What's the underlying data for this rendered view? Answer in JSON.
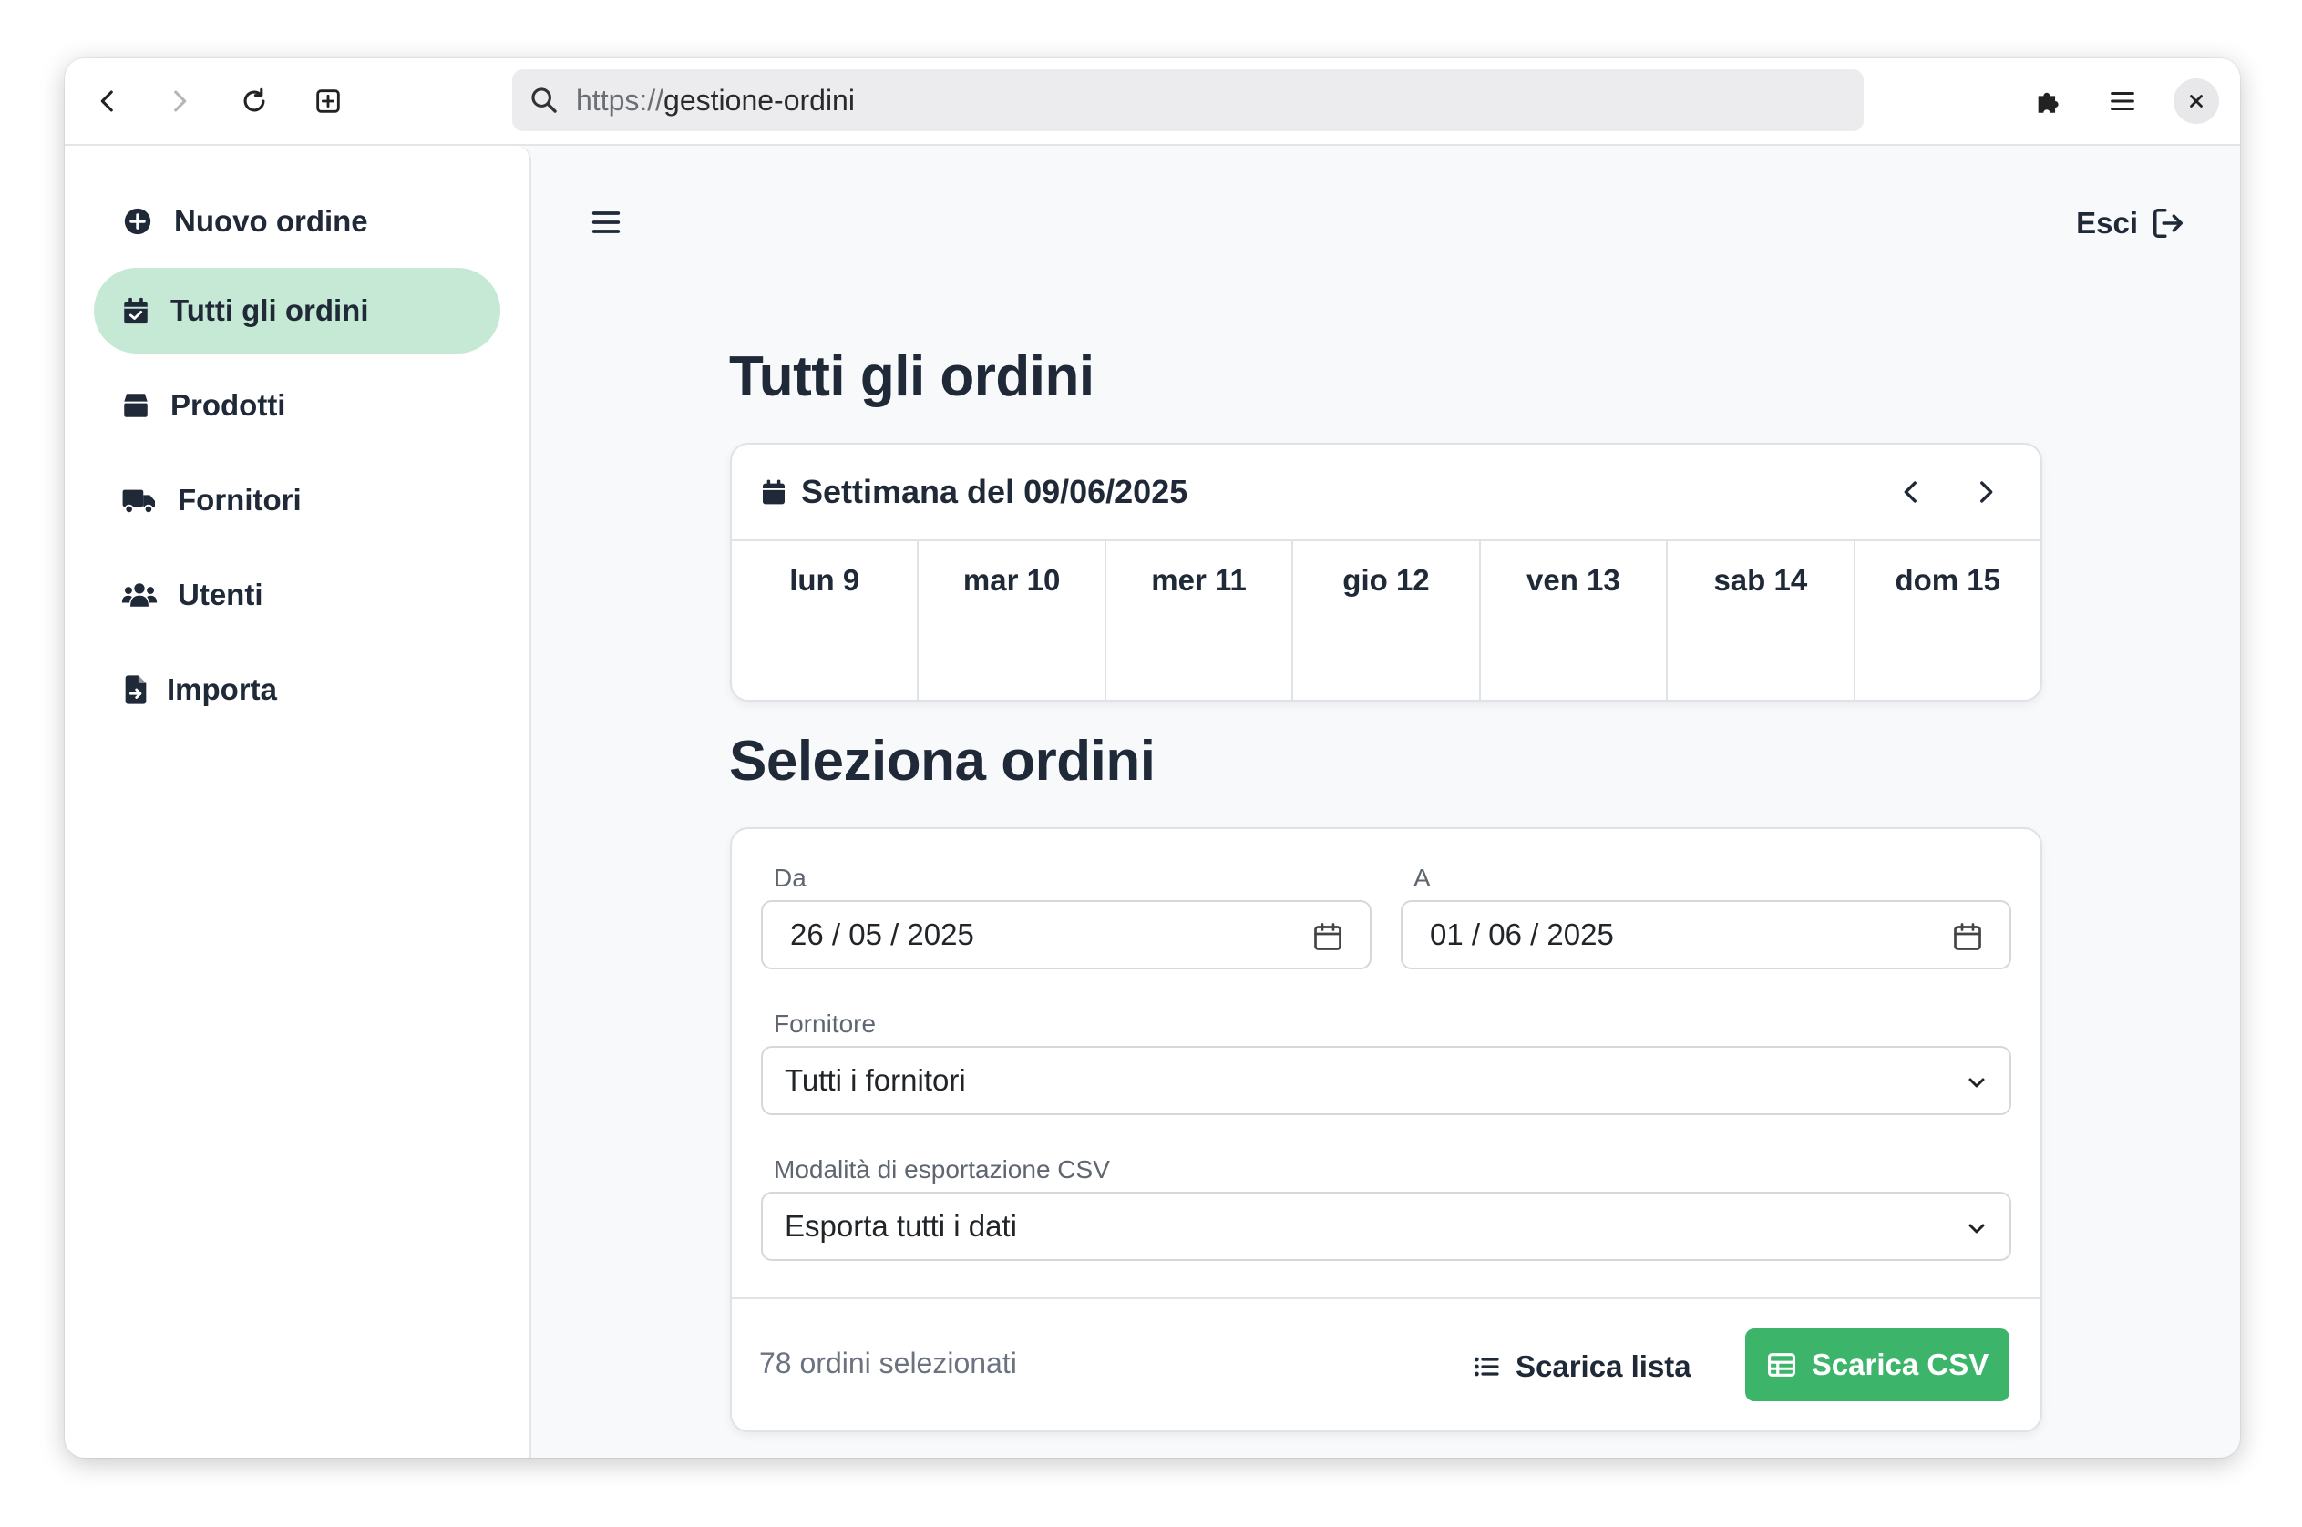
{
  "browser": {
    "url_scheme": "https://",
    "url_host": "gestione-ordini"
  },
  "sidebar": {
    "items": [
      {
        "label": "Nuovo ordine",
        "icon": "plus-circle-icon",
        "active": false
      },
      {
        "label": "Tutti gli ordini",
        "icon": "calendar-check-icon",
        "active": true
      },
      {
        "label": "Prodotti",
        "icon": "box-icon",
        "active": false
      },
      {
        "label": "Fornitori",
        "icon": "truck-icon",
        "active": false
      },
      {
        "label": "Utenti",
        "icon": "users-icon",
        "active": false
      },
      {
        "label": "Importa",
        "icon": "file-import-icon",
        "active": false
      }
    ]
  },
  "header": {
    "logout_label": "Esci"
  },
  "orders": {
    "title": "Tutti gli ordini",
    "week_title": "Settimana del 09/06/2025",
    "days": [
      "lun 9",
      "mar 10",
      "mer 11",
      "gio 12",
      "ven 13",
      "sab 14",
      "dom 15"
    ]
  },
  "select": {
    "title": "Seleziona ordini",
    "from_label": "Da",
    "from_value": "26 / 05 / 2025",
    "to_label": "A",
    "to_value": "01 / 06 / 2025",
    "supplier_label": "Fornitore",
    "supplier_value": "Tutti i fornitori",
    "export_label": "Modalità di esportazione CSV",
    "export_value": "Esporta tutti i dati",
    "count_text": "78 ordini selezionati",
    "download_list_label": "Scarica lista",
    "download_csv_label": "Scarica CSV"
  },
  "colors": {
    "accent_green": "#3cb56b",
    "active_nav_bg": "#c5e9d4",
    "text_dark": "#1f2937"
  }
}
